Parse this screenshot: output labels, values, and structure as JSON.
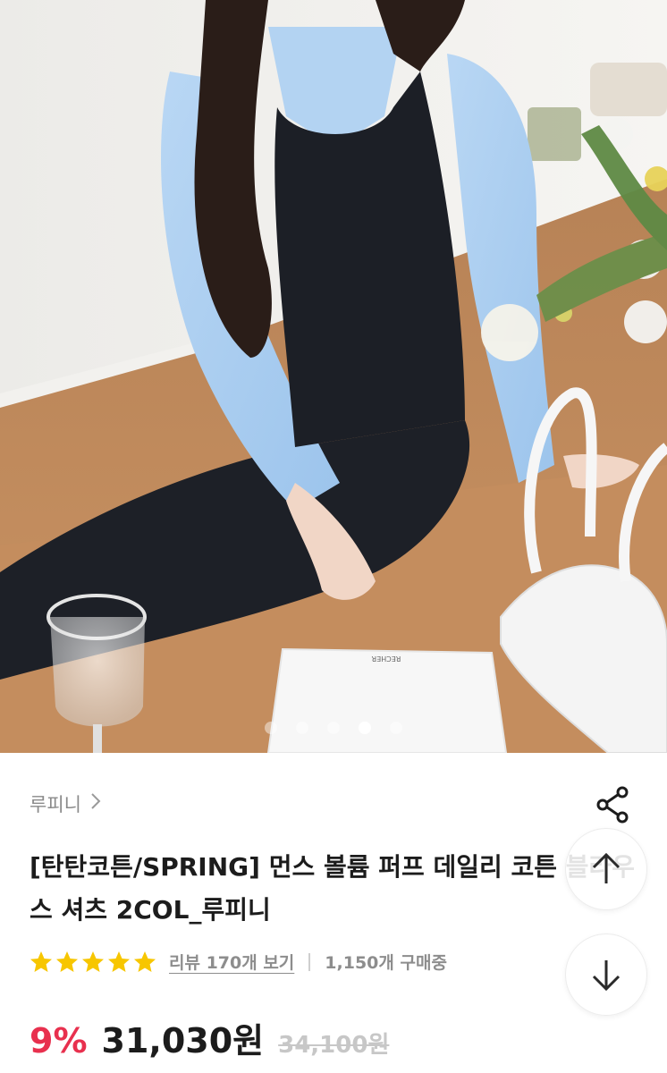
{
  "gallery": {
    "dots_total": 5,
    "active_index": 3,
    "card_brand": "RECHER"
  },
  "product": {
    "seller": "루피니",
    "title": "[탄탄코튼/SPRING] 먼스 볼륨 퍼프 데일리 코튼 블라우스 셔츠 2COL_루피니",
    "rating_stars": 5,
    "review_link": "리뷰 170개 보기",
    "purchase_count": "1,150개 구매중",
    "discount": "9%",
    "sale_price": "31,030원",
    "original_price": "34,100원"
  },
  "icons": {
    "share": "share-icon",
    "up": "arrow-up-icon",
    "down": "arrow-down-icon",
    "star": "star-icon",
    "chevron": "chevron-right-icon"
  },
  "colors": {
    "discount": "#e8304e",
    "star": "#f7c600",
    "muted": "#8d8d8d"
  }
}
